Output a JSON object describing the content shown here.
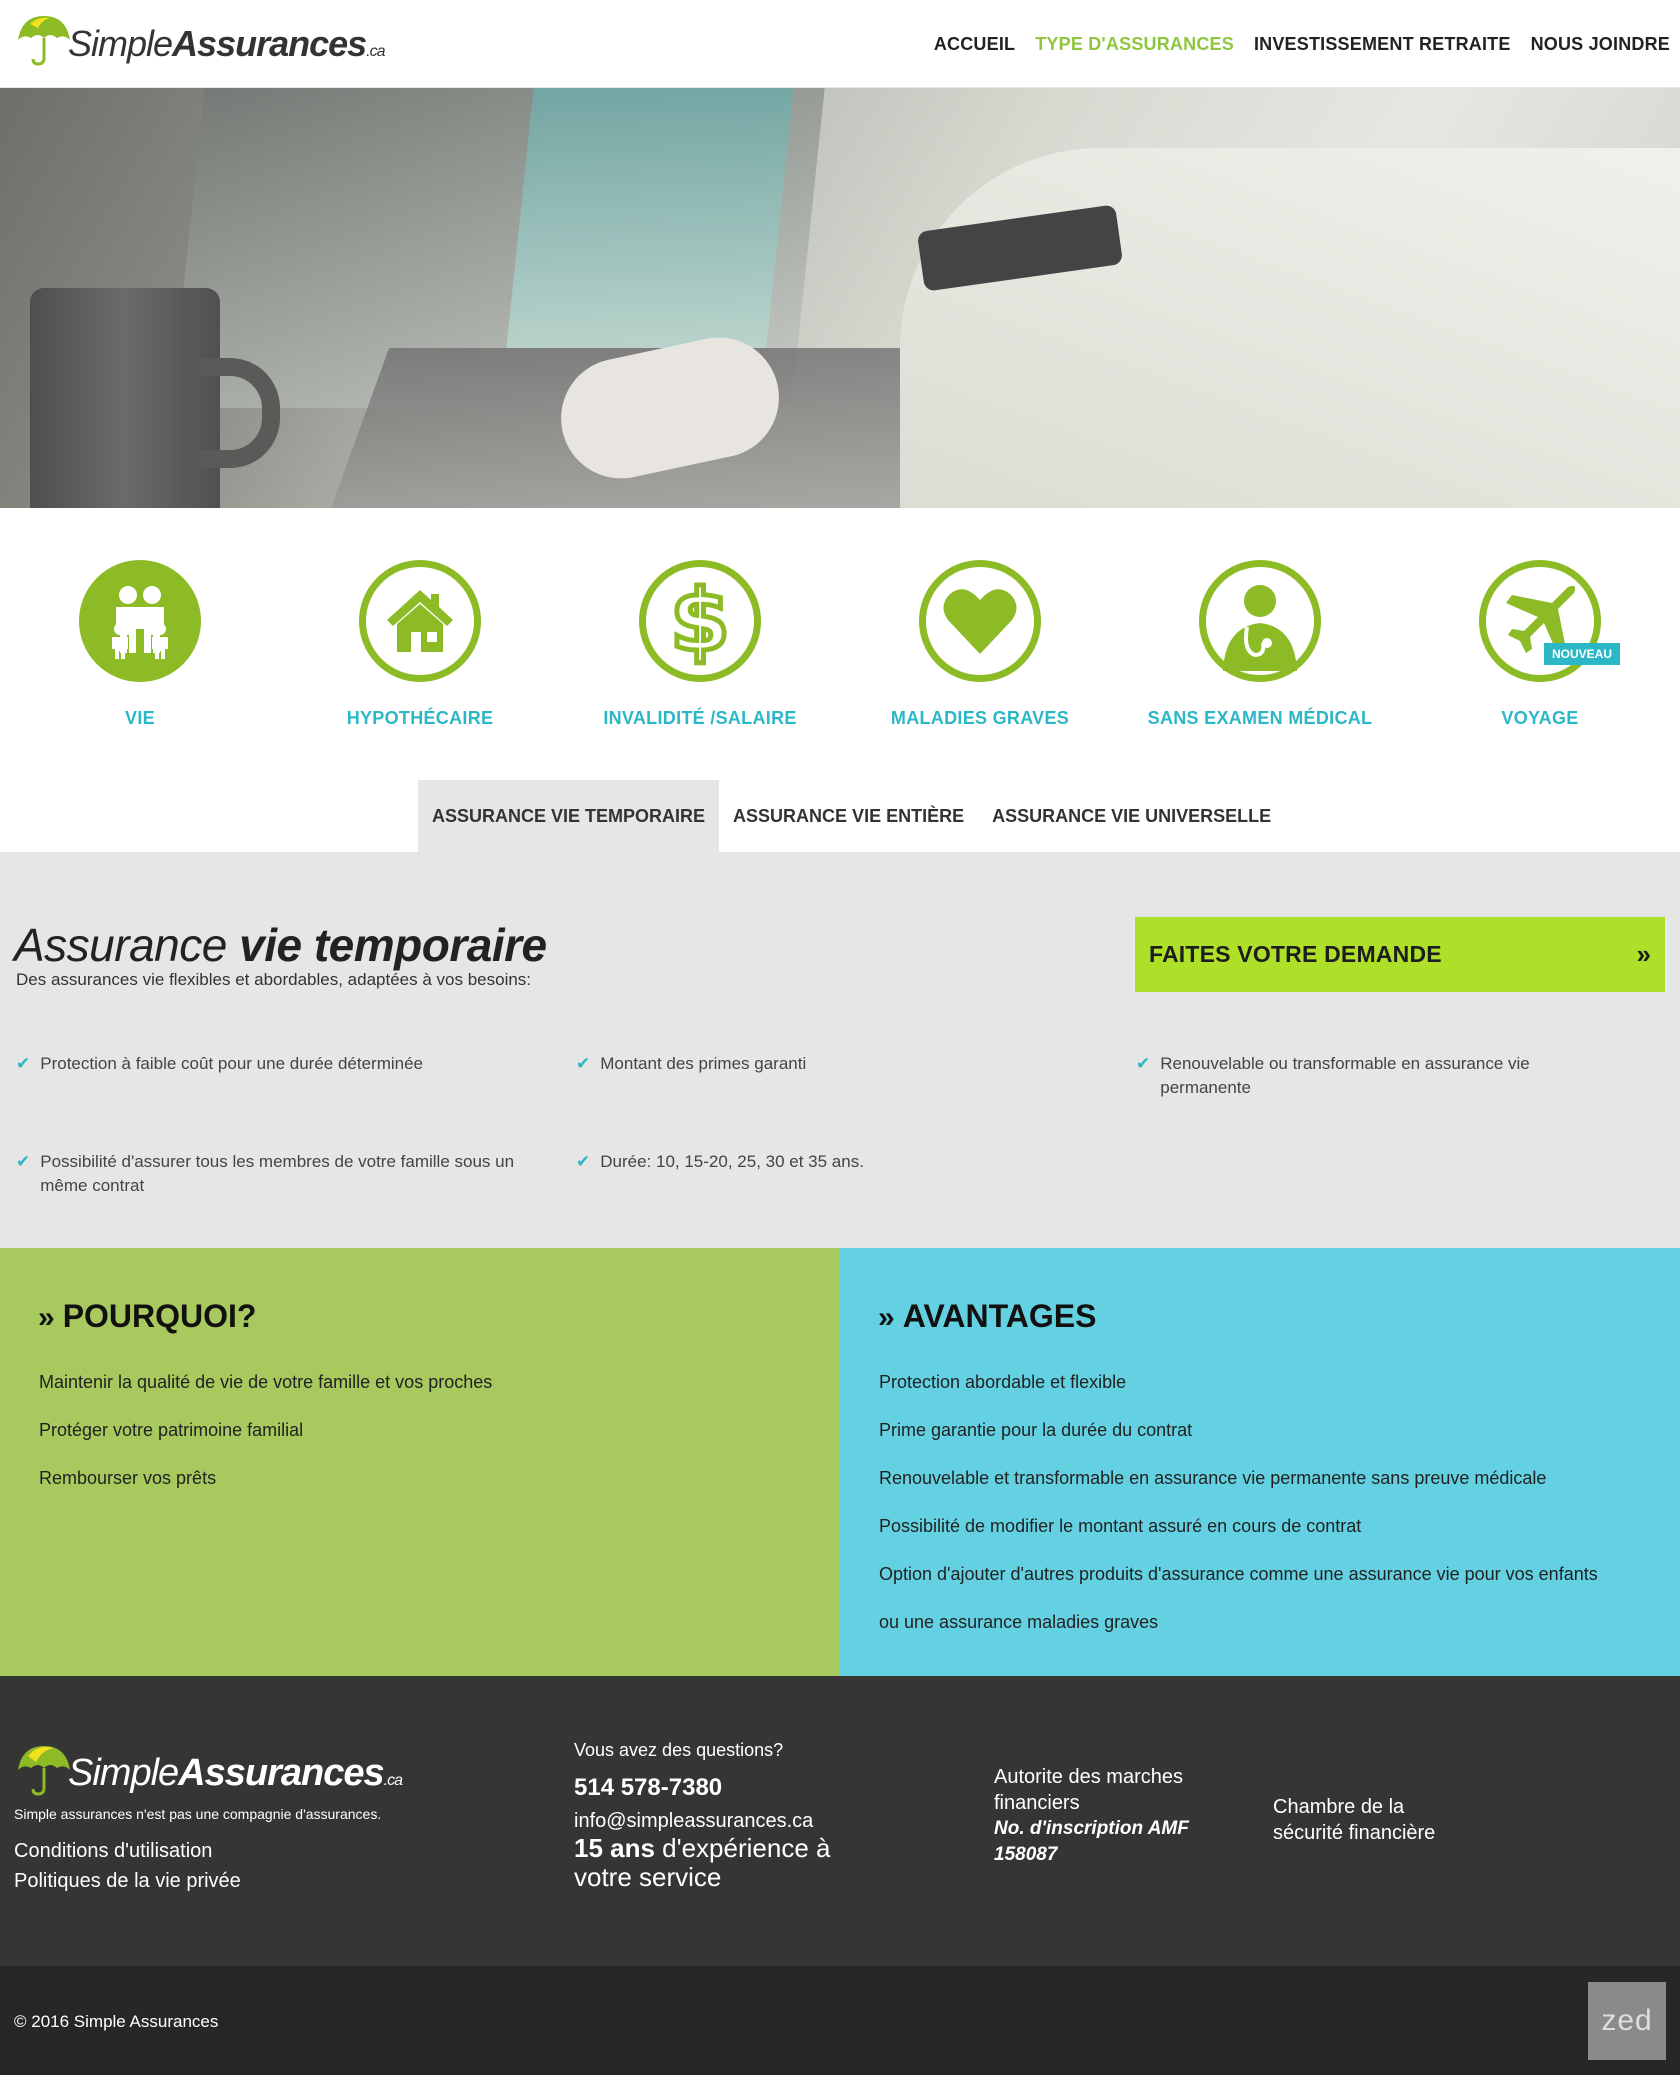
{
  "header": {
    "logo": {
      "light": "Simple",
      "bold": "Assurances",
      "ca": ".ca"
    },
    "nav": [
      {
        "label": "ACCUEIL"
      },
      {
        "label": "TYPE D'ASSURANCES"
      },
      {
        "label": "INVESTISSEMENT RETRAITE"
      },
      {
        "label": "NOUS JOINDRE"
      }
    ]
  },
  "categories": [
    {
      "label": "VIE",
      "icon": "family-icon"
    },
    {
      "label": "HYPOTHÉCAIRE",
      "icon": "house-icon"
    },
    {
      "label": "INVALIDITÉ /SALAIRE",
      "icon": "dollar-icon"
    },
    {
      "label": "MALADIES GRAVES",
      "icon": "heart-icon"
    },
    {
      "label": "SANS EXAMEN MÉDICAL",
      "icon": "doctor-icon"
    },
    {
      "label": "VOYAGE",
      "icon": "airplane-icon",
      "badge": "NOUVEAU"
    }
  ],
  "tabs": [
    {
      "label": "ASSURANCE VIE TEMPORAIRE"
    },
    {
      "label": "ASSURANCE VIE ENTIÈRE"
    },
    {
      "label": "ASSURANCE VIE UNIVERSELLE"
    }
  ],
  "intro": {
    "title_light": "Assurance",
    "title_bold": "vie temporaire",
    "subtitle": "Des assurances vie flexibles et abordables, adaptées à vos besoins:",
    "cta_label": "FAITES VOTRE DEMANDE",
    "cta_arrow": "»",
    "features": [
      "Protection à faible coût pour une durée déterminée",
      "Montant des primes garanti",
      "Renouvelable ou transformable en assurance vie permanente",
      "Possibilité d'assurer tous les membres de votre famille sous un même contrat",
      "Durée: 10, 15-20, 25, 30 et 35 ans."
    ]
  },
  "pourquoi": {
    "title": "POURQUOI?",
    "items": [
      "Maintenir la qualité de vie de votre famille et vos proches",
      "Protéger votre patrimoine familial",
      "Rembourser vos prêts"
    ]
  },
  "avantages": {
    "title": "AVANTAGES",
    "items": [
      "Protection abordable et flexible",
      "Prime garantie pour la durée du contrat",
      "Renouvelable et transformable en assurance vie permanente sans preuve médicale",
      "Possibilité de modifier le montant assuré en cours de contrat",
      "Option d'ajouter d'autres produits d'assurance comme une assurance vie pour vos enfants",
      "ou une assurance maladies graves"
    ]
  },
  "footer": {
    "tagline": "Simple assurances n'est pas une compagnie d'assurances.",
    "links": [
      "Conditions d'utilisation",
      "Politiques de la vie privée"
    ],
    "question": "Vous avez des questions?",
    "phone": "514 578-7380",
    "email": "info@simpleassurances.ca",
    "exp_bold": "15 ans",
    "exp_rest": " d'expérience à votre service",
    "amf": "Autorite des marches financiers",
    "amf_no": "No. d'inscription AMF 158087",
    "csf": "Chambre de la sécurité financière",
    "copyright": "© 2016 Simple Assurances",
    "zed": "zed"
  },
  "colors": {
    "green": "#8cbb26",
    "teal": "#2bb7c6",
    "cta": "#aee02a",
    "pourquoi_bg": "#a7c95e",
    "avantages_bg": "#63d1e2",
    "footer_bg": "#353535"
  }
}
